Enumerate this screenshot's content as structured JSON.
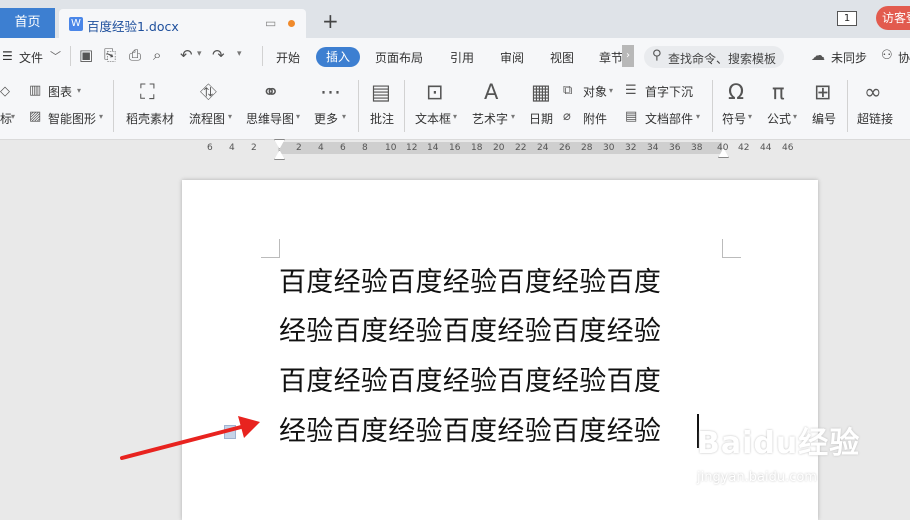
{
  "tabs": {
    "home_label": "首页",
    "doc_icon": "W",
    "doc_title": "百度经验1.docx",
    "new_tab": "+",
    "window_count": "1",
    "visitor_label": "访客登"
  },
  "menu": {
    "file": "文件",
    "items": [
      "开始",
      "插入",
      "页面布局",
      "引用",
      "审阅",
      "视图",
      "章节"
    ],
    "active": "插入",
    "search_placeholder": "查找命令、搜索模板",
    "sync": "未同步",
    "collab": "协"
  },
  "ribbon": {
    "icon_label": "图表",
    "mark_label": "标",
    "smart_shape": "智能图形",
    "daoke": "稻壳素材",
    "flowchart": "流程图",
    "mindmap": "思维导图",
    "more": "更多",
    "comment": "批注",
    "textbox": "文本框",
    "wordart": "艺术字",
    "date": "日期",
    "object": "对象",
    "attachment": "附件",
    "dropcap": "首字下沉",
    "docparts": "文档部件",
    "symbol": "符号",
    "formula": "公式",
    "numbering": "编号",
    "hyperlink": "超链接"
  },
  "ruler": {
    "numbers": [
      "6",
      "4",
      "2",
      "2",
      "4",
      "6",
      "8",
      "10",
      "12",
      "14",
      "16",
      "18",
      "20",
      "22",
      "24",
      "26",
      "28",
      "30",
      "32",
      "34",
      "36",
      "38",
      "40",
      "42",
      "44",
      "46"
    ]
  },
  "document": {
    "lines": [
      "百度经验百度经验百度经验百度",
      "经验百度经验百度经验百度经验",
      "百度经验百度经验百度经验百度",
      "经验百度经验百度经验百度经验"
    ]
  },
  "watermark": {
    "brand": "Baidu经验",
    "url": "jingyan.baidu.com"
  },
  "colors": {
    "accent": "#3d7fd1",
    "arrow": "#e8231f",
    "visitor": "#e25b4e"
  }
}
